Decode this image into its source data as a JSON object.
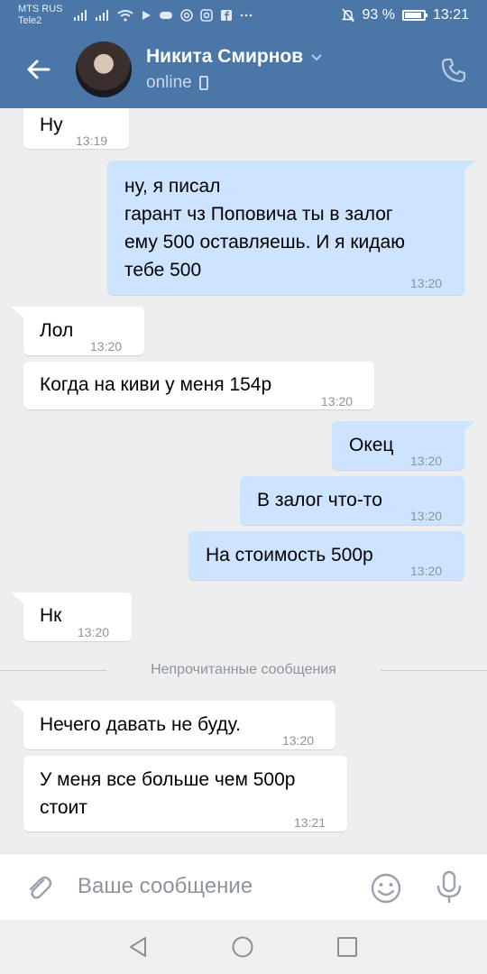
{
  "statusbar": {
    "carrier1": "MTS RUS",
    "carrier2": "Tele2",
    "battery_text": "93 %",
    "battery_level": 0.93,
    "time": "13:21",
    "icons_left": [
      "signal-icon",
      "signal-icon",
      "wifi-icon",
      "play-icon",
      "gamepad-icon",
      "at-icon",
      "instagram-icon",
      "facebook-icon",
      "more-icon"
    ],
    "icons_right": [
      "mute-icon",
      "battery-icon"
    ]
  },
  "header": {
    "contact_name": "Никита Смирнов",
    "status": "online"
  },
  "messages": [
    {
      "dir": "in",
      "text": "Ну",
      "time": "13:19"
    },
    {
      "dir": "out",
      "text": "ну, я писал\nгарант чз Поповича ты в залог\nему 500 оставляешь. И я кидаю\nтебе 500",
      "time": "13:20"
    },
    {
      "dir": "in",
      "text": "Лол",
      "time": "13:20"
    },
    {
      "dir": "in",
      "text": "Когда на киви у меня 154р",
      "time": "13:20"
    },
    {
      "dir": "out",
      "text": "Окец",
      "time": "13:20"
    },
    {
      "dir": "out",
      "text": "В залог что-то",
      "time": "13:20"
    },
    {
      "dir": "out",
      "text": "На стоимость 500р",
      "time": "13:20"
    },
    {
      "dir": "in",
      "text": "Нк",
      "time": "13:20"
    },
    {
      "dir": "in",
      "text": "Нечего давать не буду.",
      "time": "13:20"
    },
    {
      "dir": "in",
      "text": "У меня все больше чем 500р\nстоит",
      "time": "13:21"
    }
  ],
  "unread_divider": "Непрочитанные сообщения",
  "input": {
    "placeholder": "Ваше сообщение"
  },
  "colors": {
    "header_bg": "#4a76a8",
    "incoming_bubble": "#ffffff",
    "outgoing_bubble": "#cce4ff",
    "chat_bg": "#edeef0"
  }
}
